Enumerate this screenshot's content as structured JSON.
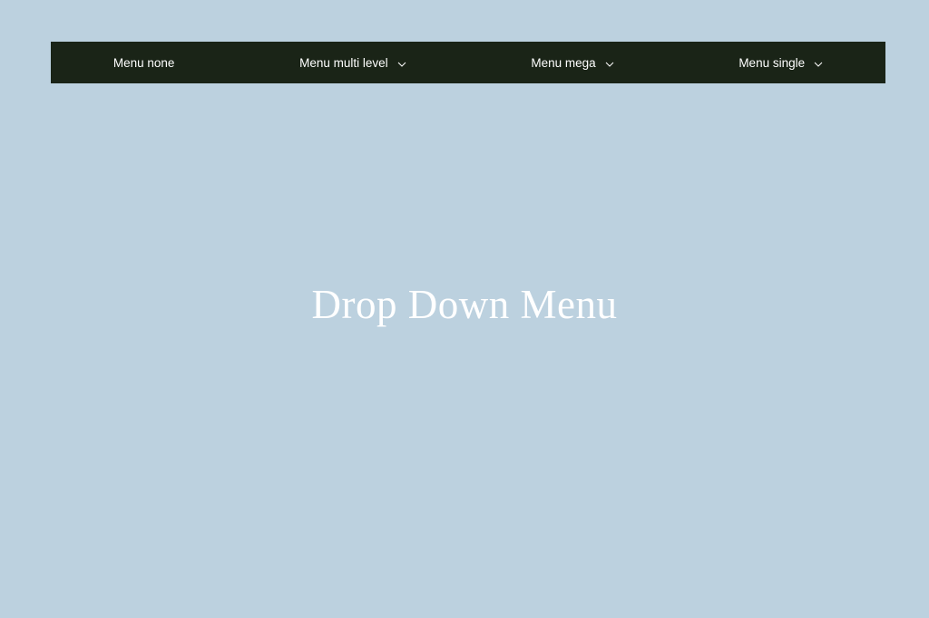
{
  "nav": {
    "items": [
      {
        "label": "Menu none",
        "hasDropdown": false
      },
      {
        "label": "Menu multi level",
        "hasDropdown": true
      },
      {
        "label": "Menu mega",
        "hasDropdown": true
      },
      {
        "label": "Menu single",
        "hasDropdown": true
      }
    ]
  },
  "page": {
    "title": "Drop Down Menu"
  }
}
